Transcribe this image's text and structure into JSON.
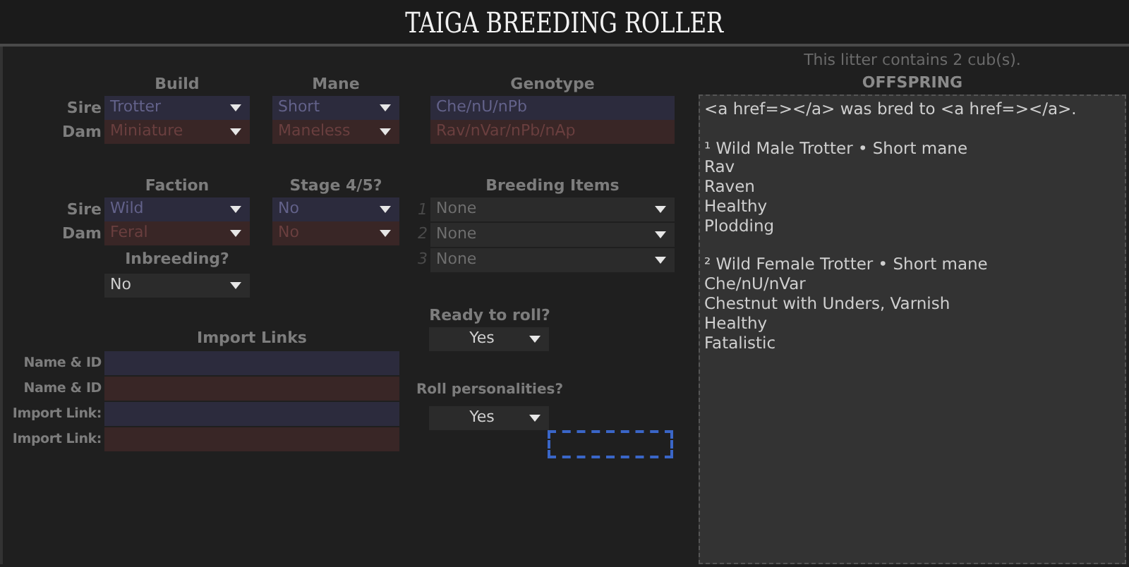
{
  "title": "TAIGA BREEDING ROLLER",
  "traits": {
    "headers": [
      "Build",
      "Mane",
      "Genotype"
    ],
    "rows": [
      {
        "label": "Sire",
        "kind": "sire",
        "build": "Trotter",
        "mane": "Short",
        "genotype": "Che/nU/nPb"
      },
      {
        "label": "Dam",
        "kind": "dam",
        "build": "Miniature",
        "mane": "Maneless",
        "genotype": "Rav/nVar/nPb/nAp"
      }
    ]
  },
  "faction": {
    "headers": [
      "Faction",
      "Stage 4/5?"
    ],
    "rows": [
      {
        "label": "Sire",
        "kind": "sire",
        "faction": "Wild",
        "stage": "No"
      },
      {
        "label": "Dam",
        "kind": "dam",
        "faction": "Feral",
        "stage": "No"
      }
    ]
  },
  "breeding_items": {
    "header": "Breeding Items",
    "items": [
      {
        "number": "1",
        "value": "None"
      },
      {
        "number": "2",
        "value": "None"
      },
      {
        "number": "3",
        "value": "None"
      }
    ]
  },
  "inbreeding": {
    "label": "Inbreeding?",
    "value": "No"
  },
  "import_links": {
    "header": "Import Links",
    "rows": [
      {
        "label": "Name & ID",
        "kind": "sire"
      },
      {
        "label": "Name & ID",
        "kind": "dam"
      },
      {
        "label": "Import Link:",
        "kind": "sire"
      },
      {
        "label": "Import Link:",
        "kind": "dam"
      }
    ]
  },
  "ready": {
    "label": "Ready to roll?",
    "value": "Yes"
  },
  "personalities": {
    "label": "Roll personalities?",
    "value": "Yes"
  },
  "extra_field": {
    "focused": true
  },
  "litter_note": "This litter contains 2 cub(s).",
  "offspring": {
    "header": "OFFSPRING",
    "intro": "<a href=></a> was bred to <a href=></a>.",
    "cubs": [
      {
        "lines": [
          "¹ Wild Male Trotter • Short mane",
          "Rav",
          "Raven",
          "Healthy",
          "Plodding"
        ]
      },
      {
        "lines": [
          "² Wild Female Trotter • Short mane",
          "Che/nU/nVar",
          "Chestnut with Unders, Varnish",
          "Healthy",
          "Fatalistic"
        ]
      }
    ]
  }
}
